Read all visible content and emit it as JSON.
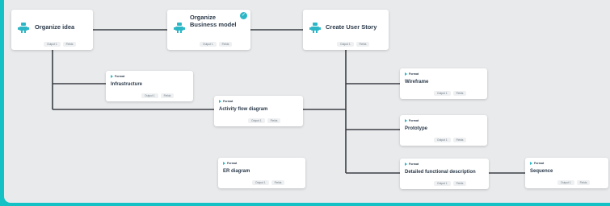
{
  "colors": {
    "frame": "#14c1c4",
    "canvas": "#e9eaec",
    "accent": "#2db7c6",
    "edge": "#3a3f44"
  },
  "nodes": {
    "organize_idea": {
      "title": "Organize idea",
      "icon": "robot-icon",
      "badges": [
        "Output 1",
        "Fields"
      ]
    },
    "organize_business_model": {
      "title_line1": "Organize",
      "title_line2": "Business model",
      "icon": "robot-icon",
      "badges": [
        "Output 1",
        "Fields"
      ],
      "status": "check-icon"
    },
    "create_user_story": {
      "title": "Create User Story",
      "icon": "robot-icon",
      "badges": [
        "Output 1",
        "Fields"
      ]
    },
    "infrastructure": {
      "tag": "Format",
      "title": "Infrastructure",
      "badges": [
        "Output 1",
        "Fields"
      ]
    },
    "activity_flow_diagram": {
      "tag": "Format",
      "title": "Activity flow diagram",
      "badges": [
        "Output 1",
        "Fields"
      ]
    },
    "wireframe": {
      "tag": "Format",
      "title": "Wireframe",
      "badges": [
        "Output 1",
        "Fields"
      ]
    },
    "prototype": {
      "tag": "Format",
      "title": "Prototype",
      "badges": [
        "Output 1",
        "Fields"
      ]
    },
    "detailed_functional_description": {
      "tag": "Format",
      "title": "Detailed functional description",
      "badges": [
        "Output 1",
        "Fields"
      ]
    },
    "er_diagram": {
      "tag": "Format",
      "title": "ER diagram",
      "badges": [
        "Output 1",
        "Fields"
      ]
    },
    "sequence": {
      "tag": "Format",
      "title": "Sequence",
      "badges": [
        "Output 1",
        "Fields"
      ]
    }
  }
}
